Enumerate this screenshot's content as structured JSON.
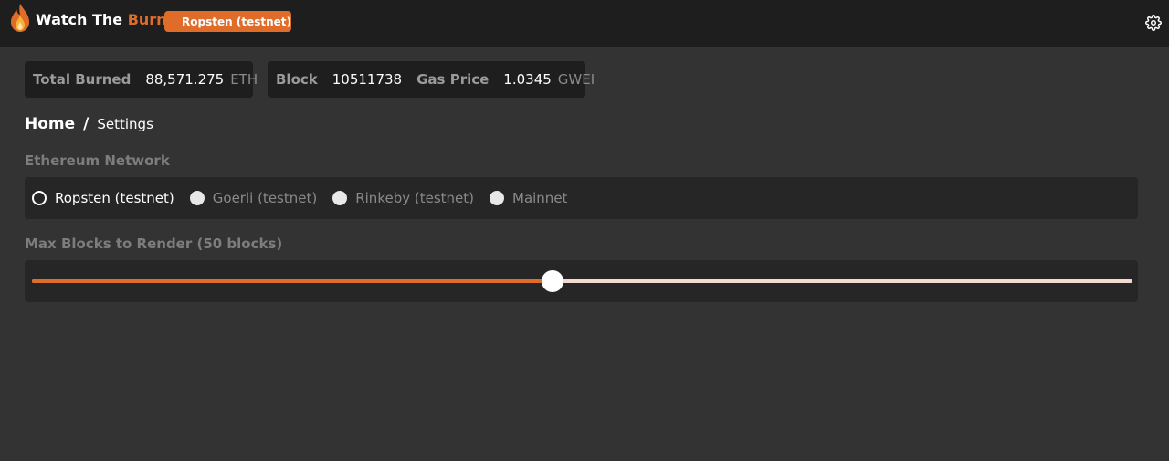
{
  "header": {
    "title_main": "Watch The ",
    "title_accent": "Burn",
    "network_badge": "Ropsten (testnet)"
  },
  "stats": {
    "total_burned_label": "Total Burned",
    "total_burned_value": "88,571.275",
    "total_burned_unit": "ETH",
    "block_label": "Block",
    "block_value": "10511738",
    "gas_label": "Gas Price",
    "gas_value": "1.0345",
    "gas_unit": "GWEI"
  },
  "breadcrumb": {
    "home": "Home",
    "separator": "/",
    "current": "Settings"
  },
  "network_section": {
    "label": "Ethereum Network",
    "options": [
      {
        "label": "Ropsten (testnet)",
        "selected": true
      },
      {
        "label": "Goerli (testnet)",
        "selected": false
      },
      {
        "label": "Rinkeby (testnet)",
        "selected": false
      },
      {
        "label": "Mainnet",
        "selected": false
      }
    ]
  },
  "blocks_section": {
    "label": "Max Blocks to Render (50 blocks)",
    "slider_fraction": 0.473
  },
  "colors": {
    "accent": "#e06c2a",
    "header_bg": "#1e1e1e",
    "page_bg": "#333333"
  },
  "icons": {
    "logo": "flame-icon",
    "badge": "ethereum-icon",
    "settings": "gear-icon"
  }
}
